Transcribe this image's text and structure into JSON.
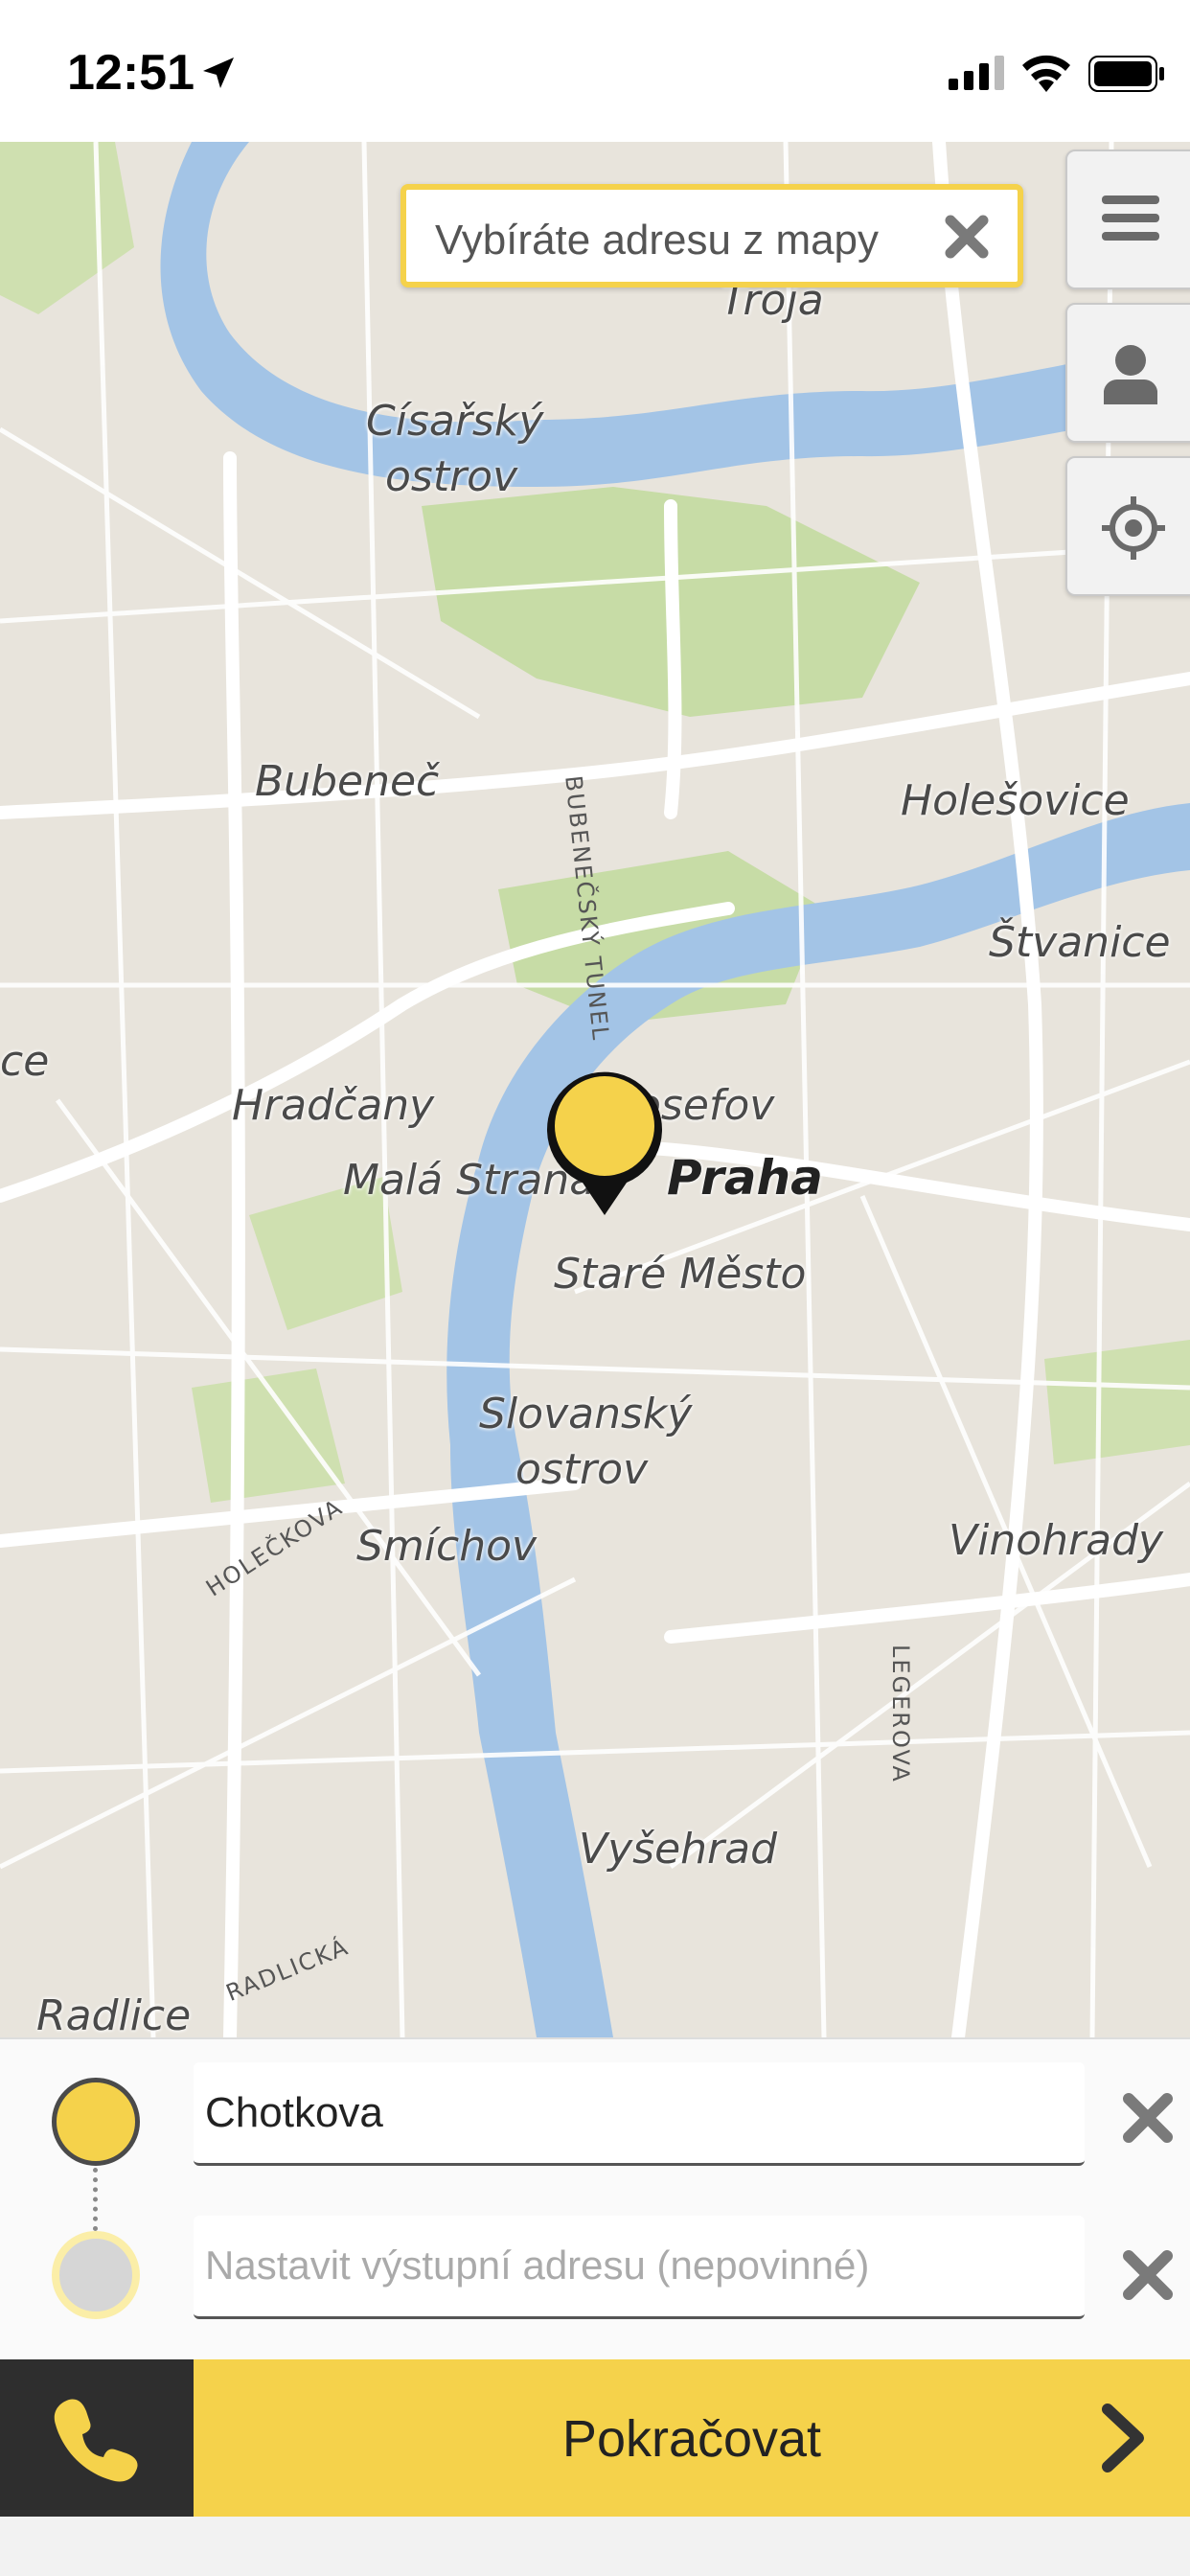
{
  "status_bar": {
    "time": "12:51"
  },
  "map": {
    "search_prompt": "Vybíráte adresu z mapy",
    "labels": {
      "troja": "Troja",
      "cisarsky": "Císařský",
      "ostrov1": "ostrov",
      "bubenec": "Bubeneč",
      "holesovice": "Holešovice",
      "stvanice": "Štvanice",
      "ce": "ce",
      "hradcany": "Hradčany",
      "josefov": "Josefov",
      "mala_strana": "Malá Strana",
      "praha": "Praha",
      "stare_mesto": "Staré Město",
      "slovansky": "Slovanský",
      "ostrov2": "ostrov",
      "smichov": "Smíchov",
      "vinohrady": "Vinohrady",
      "vysehrad": "Vyšehrad",
      "radlice": "Radlice"
    },
    "road_labels": {
      "bubenecsky_tunel": "BUBENEČSKÝ TUNEL",
      "holeckova": "HOLEČKOVA",
      "legerova": "LEGEROVA",
      "radlicka": "RADLICKÁ"
    }
  },
  "trip": {
    "pickup_value": "Chotkova",
    "destination_placeholder": "Nastavit výstupní adresu (nepovinné)"
  },
  "actions": {
    "continue_label": "Pokračovat"
  },
  "colors": {
    "accent": "#f5d24b",
    "water": "#a3c4e6",
    "park": "#c7dca6",
    "land": "#e8e4dc",
    "dark": "#2e2e2e"
  }
}
